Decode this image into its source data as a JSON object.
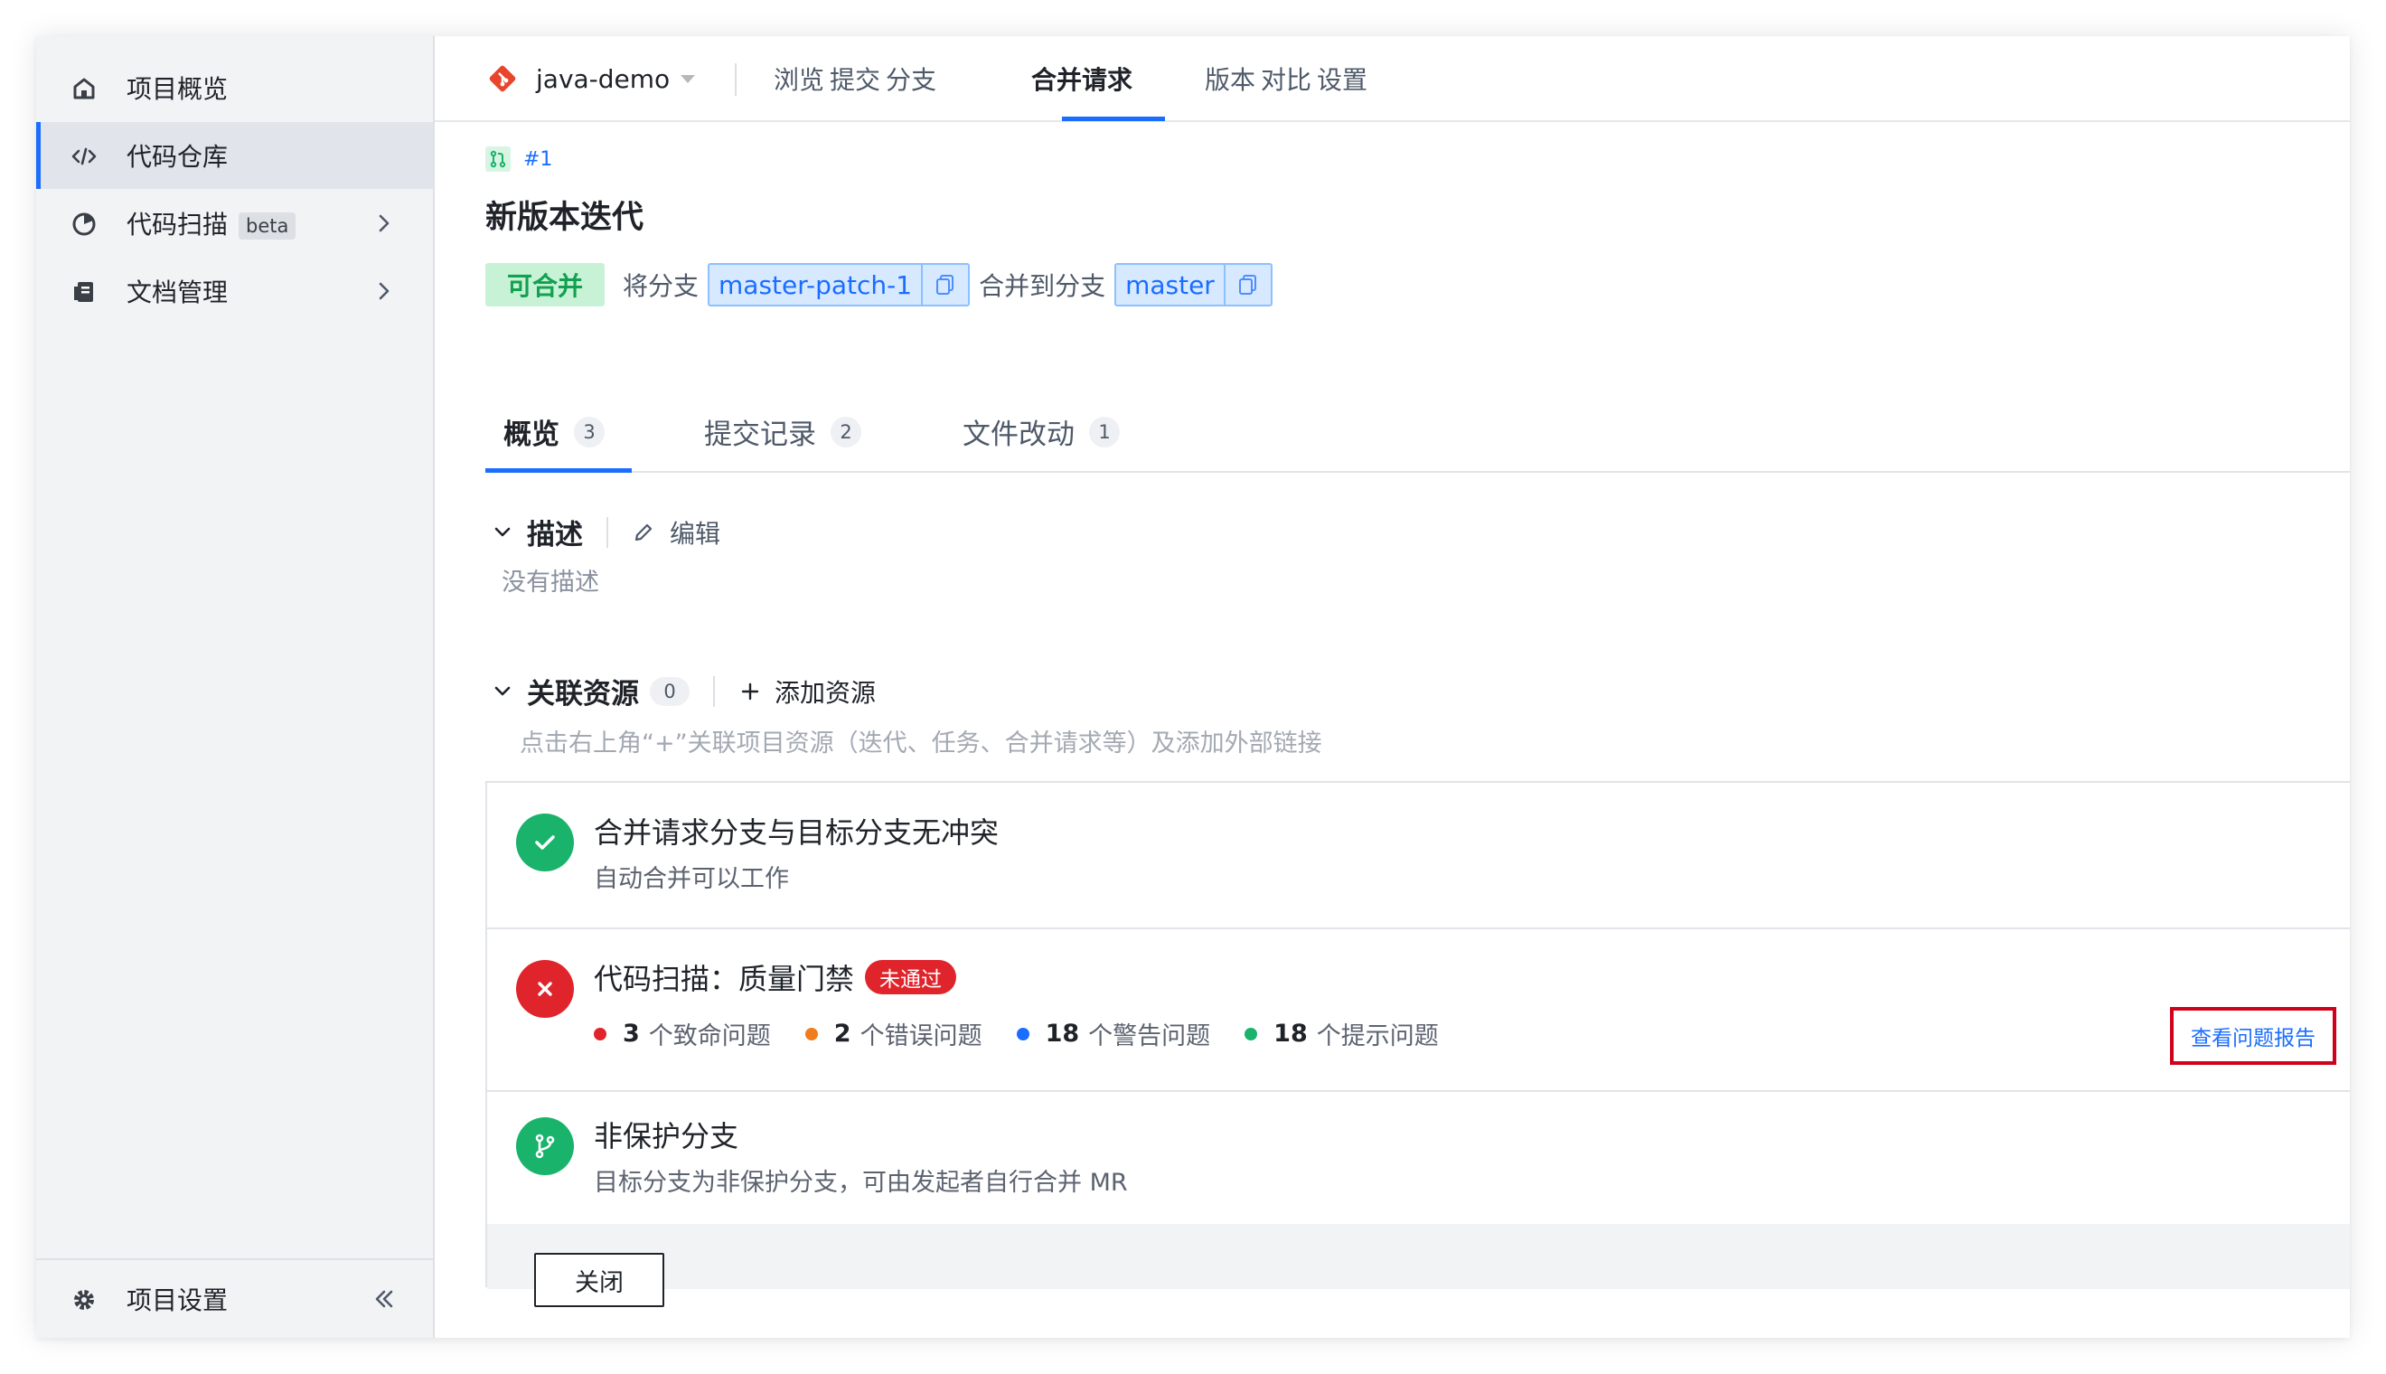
{
  "sidebar": {
    "items": [
      {
        "label": "项目概览",
        "icon": "home-icon"
      },
      {
        "label": "代码仓库",
        "icon": "code-icon"
      },
      {
        "label": "代码扫描",
        "icon": "scan-icon",
        "badge": "beta"
      },
      {
        "label": "文档管理",
        "icon": "document-icon"
      }
    ],
    "footer": {
      "label": "项目设置",
      "icon": "gear-icon"
    }
  },
  "topnav": {
    "repo": "java-demo",
    "tabs": [
      "浏览",
      "提交",
      "分支",
      "合并请求",
      "版本",
      "对比",
      "设置"
    ],
    "active_tab": "合并请求"
  },
  "mr": {
    "id": "#1",
    "title": "新版本迭代",
    "status": "可合并",
    "from_label": "将分支",
    "source_branch": "master-patch-1",
    "into_label": "合并到分支",
    "target_branch": "master"
  },
  "tabs": [
    {
      "label": "概览",
      "count": "3"
    },
    {
      "label": "提交记录",
      "count": "2"
    },
    {
      "label": "文件改动",
      "count": "1"
    }
  ],
  "description": {
    "heading": "描述",
    "edit_label": "编辑",
    "empty_text": "没有描述"
  },
  "resources": {
    "heading": "关联资源",
    "count": "0",
    "add_label": "添加资源",
    "hint": "点击右上角“+”关联项目资源（迭代、任务、合并请求等）及添加外部链接"
  },
  "checks": {
    "conflict": {
      "title": "合并请求分支与目标分支无冲突",
      "subtitle": "自动合并可以工作"
    },
    "scan": {
      "title": "代码扫描：质量门禁",
      "tag": "未通过",
      "stats": [
        {
          "num": "3",
          "label": "个致命问题",
          "color": "#e0242c"
        },
        {
          "num": "2",
          "label": "个错误问题",
          "color": "#f07c1b"
        },
        {
          "num": "18",
          "label": "个警告问题",
          "color": "#1a6dff"
        },
        {
          "num": "18",
          "label": "个提示问题",
          "color": "#19b36b"
        }
      ],
      "report_label": "查看问题报告"
    },
    "protection": {
      "title": "非保护分支",
      "subtitle": "目标分支为非保护分支，可由发起者自行合并 MR"
    }
  },
  "footer": {
    "close_label": "关闭"
  },
  "colors": {
    "accent": "#1a6dff",
    "success": "#19b36b",
    "danger": "#e0242c"
  }
}
